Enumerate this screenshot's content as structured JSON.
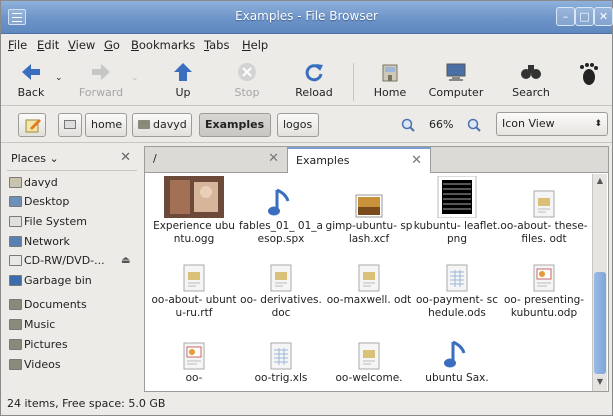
{
  "window": {
    "title": "Examples - File Browser"
  },
  "menubar": [
    {
      "key": "F",
      "rest": "ile"
    },
    {
      "key": "E",
      "rest": "dit"
    },
    {
      "key": "V",
      "rest": "iew"
    },
    {
      "key": "G",
      "rest": "o"
    },
    {
      "key": "B",
      "rest": "ookmarks"
    },
    {
      "key": "T",
      "rest": "abs"
    },
    {
      "key": "H",
      "rest": "elp"
    }
  ],
  "toolbar": {
    "back": "Back",
    "forward": "Forward",
    "up": "Up",
    "stop": "Stop",
    "reload": "Reload",
    "home": "Home",
    "computer": "Computer",
    "search": "Search"
  },
  "location": {
    "home": "home",
    "davyd": "davyd",
    "examples": "Examples",
    "logos": "logos",
    "zoom": "66%",
    "view": "Icon View"
  },
  "sidebar": {
    "header": "Places",
    "items": [
      "davyd",
      "Desktop",
      "File System",
      "Network",
      "CD-RW/DVD-...",
      "Garbage bin",
      "Documents",
      "Music",
      "Pictures",
      "Videos"
    ]
  },
  "tabs": [
    {
      "label": "/"
    },
    {
      "label": "Examples"
    }
  ],
  "files": [
    {
      "name": "Experience ubuntu.ogg",
      "kind": "video"
    },
    {
      "name": "fables_01_ 01_aesop.spx",
      "kind": "audio"
    },
    {
      "name": "gimp-ubuntu- splash.xcf",
      "kind": "image"
    },
    {
      "name": "kubuntu- leaflet.png",
      "kind": "leaflet"
    },
    {
      "name": "oo-about- these-files. odt",
      "kind": "doc"
    },
    {
      "name": "oo-about- ubuntu-ru.rtf",
      "kind": "doc"
    },
    {
      "name": "oo- derivatives. doc",
      "kind": "doc"
    },
    {
      "name": "oo-maxwell. odt",
      "kind": "doc"
    },
    {
      "name": "oo-payment- schedule.ods",
      "kind": "sheet"
    },
    {
      "name": "oo- presenting- kubuntu.odp",
      "kind": "presentation"
    },
    {
      "name": "oo-",
      "kind": "presentation"
    },
    {
      "name": "oo-trig.xls",
      "kind": "sheet"
    },
    {
      "name": "oo-welcome.",
      "kind": "doc"
    },
    {
      "name": "ubuntu Sax.",
      "kind": "audio"
    }
  ],
  "status": "24 items, Free space: 5.0 GB"
}
